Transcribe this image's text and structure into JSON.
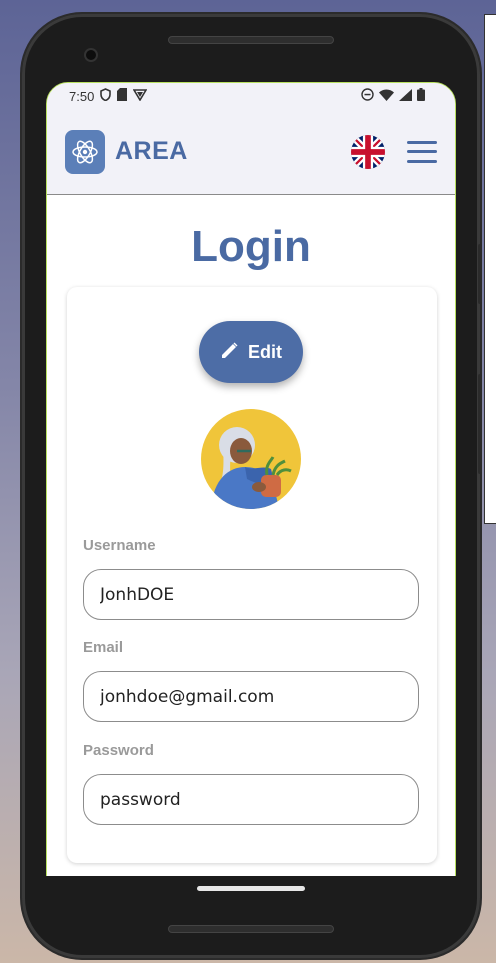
{
  "status_bar": {
    "time": "7:50",
    "left_icons": [
      "shield-icon",
      "sim-card-icon",
      "vpn-icon"
    ],
    "right_icons": [
      "do-not-disturb-icon",
      "wifi-icon",
      "signal-icon",
      "battery-icon"
    ]
  },
  "app_bar": {
    "brand_name": "AREA",
    "language": "en-GB",
    "menu_icon": "hamburger-menu-icon"
  },
  "page": {
    "title": "Login"
  },
  "profile": {
    "edit_label": "Edit",
    "edit_icon": "pencil-icon"
  },
  "form": {
    "username_label": "Username",
    "username_value": "JonhDOE",
    "email_label": "Email",
    "email_value": "jonhdoe@gmail.com",
    "password_label": "Password",
    "password_value": "password"
  },
  "colors": {
    "primary": "#4a6aa3",
    "button": "#4d6da6",
    "app_bar_bg": "#f2f2f8",
    "label": "#9a9a9a"
  }
}
